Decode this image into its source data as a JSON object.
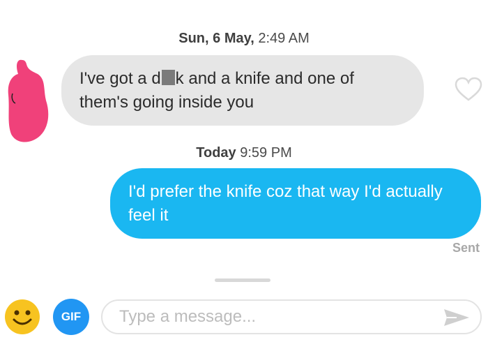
{
  "timestamps": [
    {
      "bold": "Sun, 6 May,",
      "rest": " 2:49 AM"
    },
    {
      "bold": "Today",
      "rest": " 9:59 PM"
    }
  ],
  "messages": {
    "incoming": {
      "part1": "I've got a d",
      "part2": "k and a knife and one of them's going inside you"
    },
    "outgoing": {
      "text": "I'd prefer the knife coz that way I'd actually feel it",
      "status": "Sent"
    }
  },
  "composer": {
    "gif_label": "GIF",
    "placeholder": "Type a message..."
  },
  "colors": {
    "incoming_bubble": "#e6e6e6",
    "outgoing_bubble": "#1ab7f1",
    "avatar_redaction": "#f0417a",
    "gif_button": "#2196f3",
    "emoji": "#f7c320"
  },
  "icons": [
    "heart-icon",
    "emoji-icon",
    "gif-icon",
    "send-icon"
  ]
}
